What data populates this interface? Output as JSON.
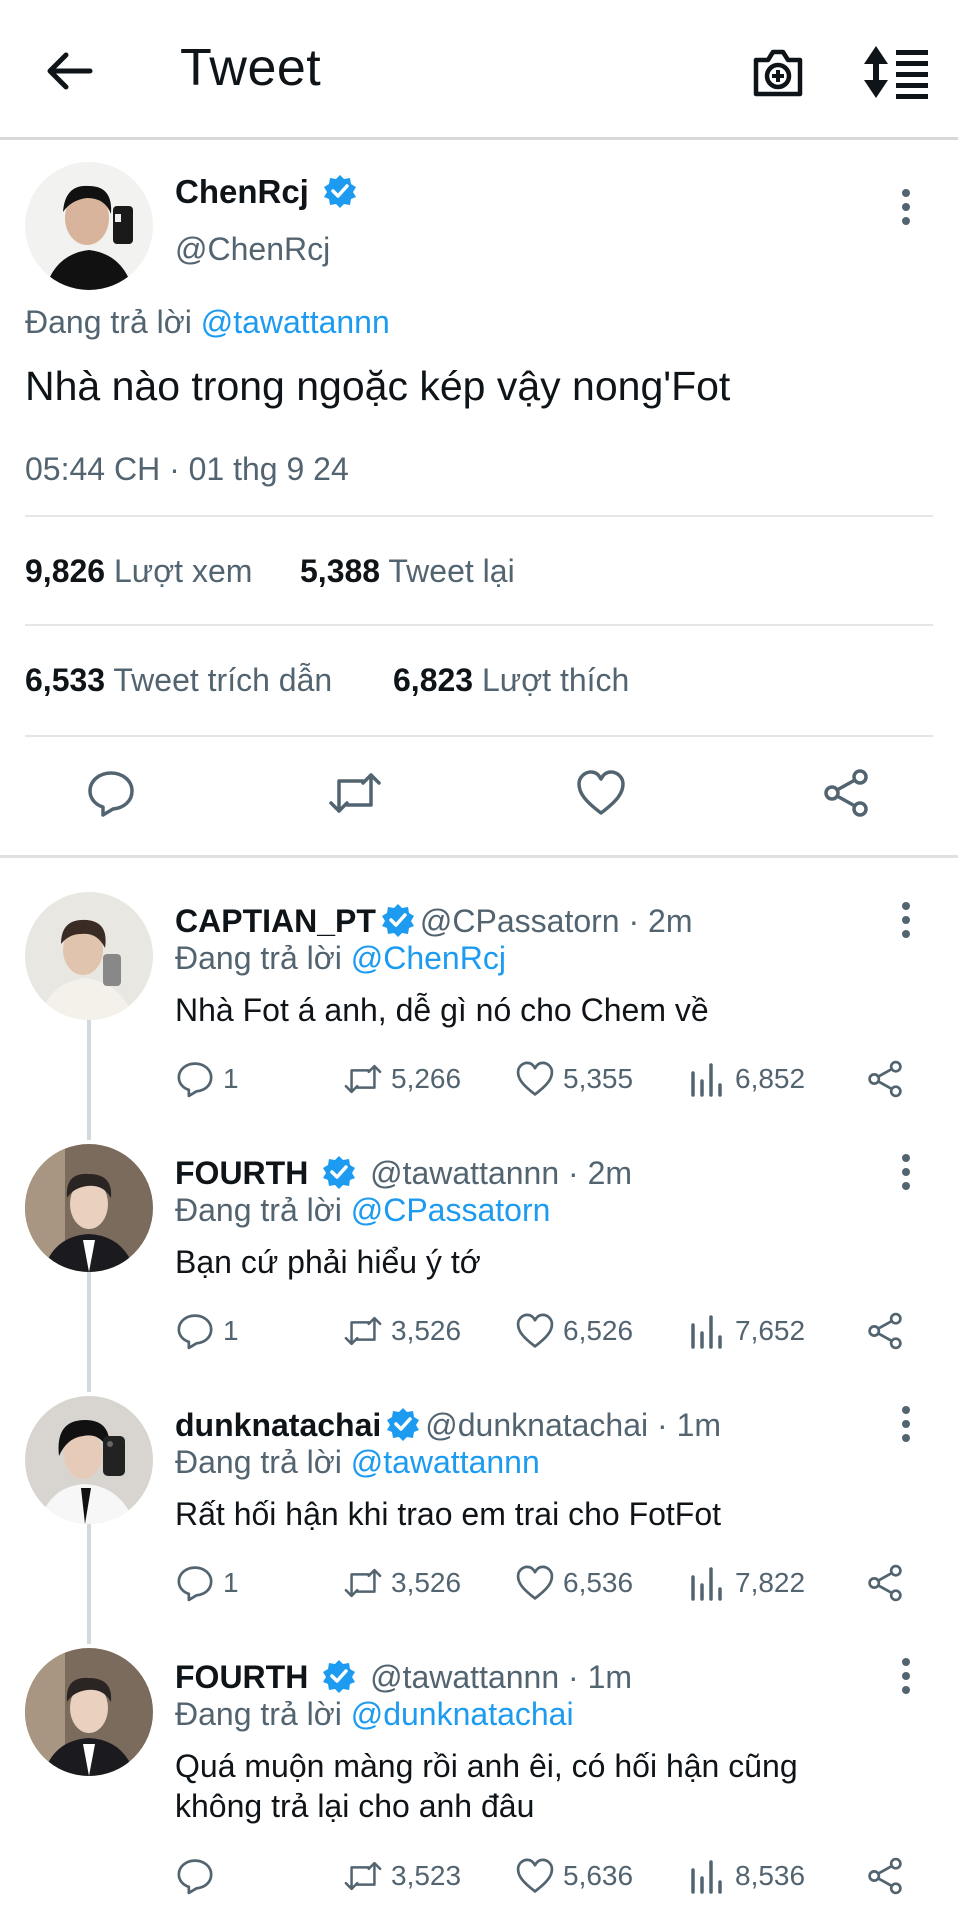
{
  "header": {
    "title": "Tweet"
  },
  "main_tweet": {
    "name": "ChenRcj",
    "handle": "@ChenRcj",
    "reply_prefix": "Đang trả lời",
    "reply_to": "@tawattannn",
    "text": "Nhà nào trong ngoặc kép vậy nong'Fot",
    "time": "05:44 CH · 01 thg 9 24",
    "stats": {
      "views_count": "9,826",
      "views_label": "Lượt xem",
      "retweets_count": "5,388",
      "retweets_label": "Tweet lại",
      "quotes_count": "6,533",
      "quotes_label": "Tweet trích dẫn",
      "likes_count": "6,823",
      "likes_label": "Lượt thích"
    }
  },
  "replies": [
    {
      "name": "CAPTIAN_PT",
      "meta": "@CPassatorn · 2m",
      "reply_prefix": "Đang trả lời",
      "reply_to": "@ChenRcj",
      "text": "Nhà Fot á anh, dễ gì nó cho Chem về",
      "replies": "1",
      "retweets": "5,266",
      "likes": "5,355",
      "views": "6,852"
    },
    {
      "name": "FOURTH",
      "meta": "@tawattannn · 2m",
      "reply_prefix": "Đang trả lời",
      "reply_to": "@CPassatorn",
      "text": "Bạn cứ phải hiểu ý tớ",
      "replies": "1",
      "retweets": "3,526",
      "likes": "6,526",
      "views": "7,652"
    },
    {
      "name": "dunknatachai",
      "meta": "@dunknatachai · 1m",
      "reply_prefix": "Đang trả lời",
      "reply_to": "@tawattannn",
      "text": "Rất hối hận khi trao em trai cho FotFot",
      "replies": "1",
      "retweets": "3,526",
      "likes": "6,536",
      "views": "7,822"
    },
    {
      "name": "FOURTH",
      "meta": "@tawattannn · 1m",
      "reply_prefix": "Đang trả lời",
      "reply_to": "@dunknatachai",
      "text_line1": "Quá muộn màng rồi anh êi, có hối hận cũng",
      "text_line2": "không trả lại cho anh đâu",
      "replies": "",
      "retweets": "3,523",
      "likes": "5,636",
      "views": "8,536"
    }
  ],
  "colors": {
    "accent": "#1d9bf0",
    "secondary_text": "#536471",
    "primary_text": "#0f1419"
  }
}
